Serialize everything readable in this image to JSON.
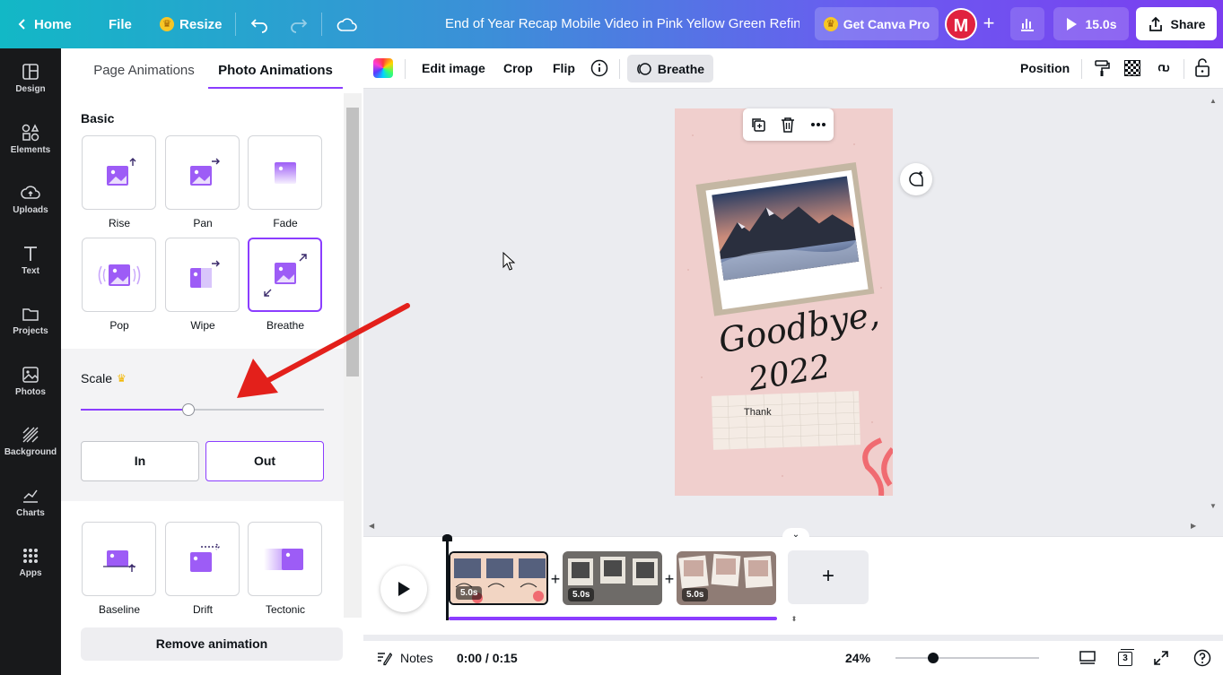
{
  "topbar": {
    "home": "Home",
    "file": "File",
    "resize": "Resize",
    "title": "End of Year Recap Mobile Video in Pink Yellow Green Refine...",
    "get_pro": "Get Canva Pro",
    "avatar_initial": "M",
    "play_duration": "15.0s",
    "share": "Share"
  },
  "rail": {
    "items": [
      {
        "label": "Design",
        "icon": "design-icon"
      },
      {
        "label": "Elements",
        "icon": "elements-icon"
      },
      {
        "label": "Uploads",
        "icon": "uploads-icon"
      },
      {
        "label": "Text",
        "icon": "text-icon"
      },
      {
        "label": "Projects",
        "icon": "projects-icon"
      },
      {
        "label": "Photos",
        "icon": "photos-icon"
      },
      {
        "label": "Background",
        "icon": "background-icon"
      },
      {
        "label": "Charts",
        "icon": "charts-icon"
      },
      {
        "label": "Apps",
        "icon": "apps-icon"
      }
    ]
  },
  "panel": {
    "tabs": [
      "Page Animations",
      "Photo Animations"
    ],
    "section_basic": "Basic",
    "animations": [
      "Rise",
      "Pan",
      "Fade",
      "Pop",
      "Wipe",
      "Breathe"
    ],
    "selected_animation": "Breathe",
    "scale_label": "Scale",
    "scale_level_percent": 44,
    "direction": {
      "in": "In",
      "out": "Out",
      "selected": "Out"
    },
    "more_animations": [
      "Baseline",
      "Drift",
      "Tectonic"
    ],
    "remove": "Remove animation"
  },
  "context_toolbar": {
    "edit_image": "Edit image",
    "crop": "Crop",
    "flip": "Flip",
    "active_animation": "Breathe",
    "position": "Position"
  },
  "design": {
    "heading": "Goodbye,",
    "year": "2022",
    "note": "Thank"
  },
  "timeline": {
    "clips": [
      "5.0s",
      "5.0s",
      "5.0s"
    ],
    "add_page": "+"
  },
  "bottombar": {
    "notes": "Notes",
    "time": "0:00 / 0:15",
    "zoom": "24%",
    "page_count": "3"
  },
  "colors": {
    "accent": "#8b3dff",
    "design_bg": "#f0cfcd",
    "annotation_arrow": "#e3201b"
  }
}
